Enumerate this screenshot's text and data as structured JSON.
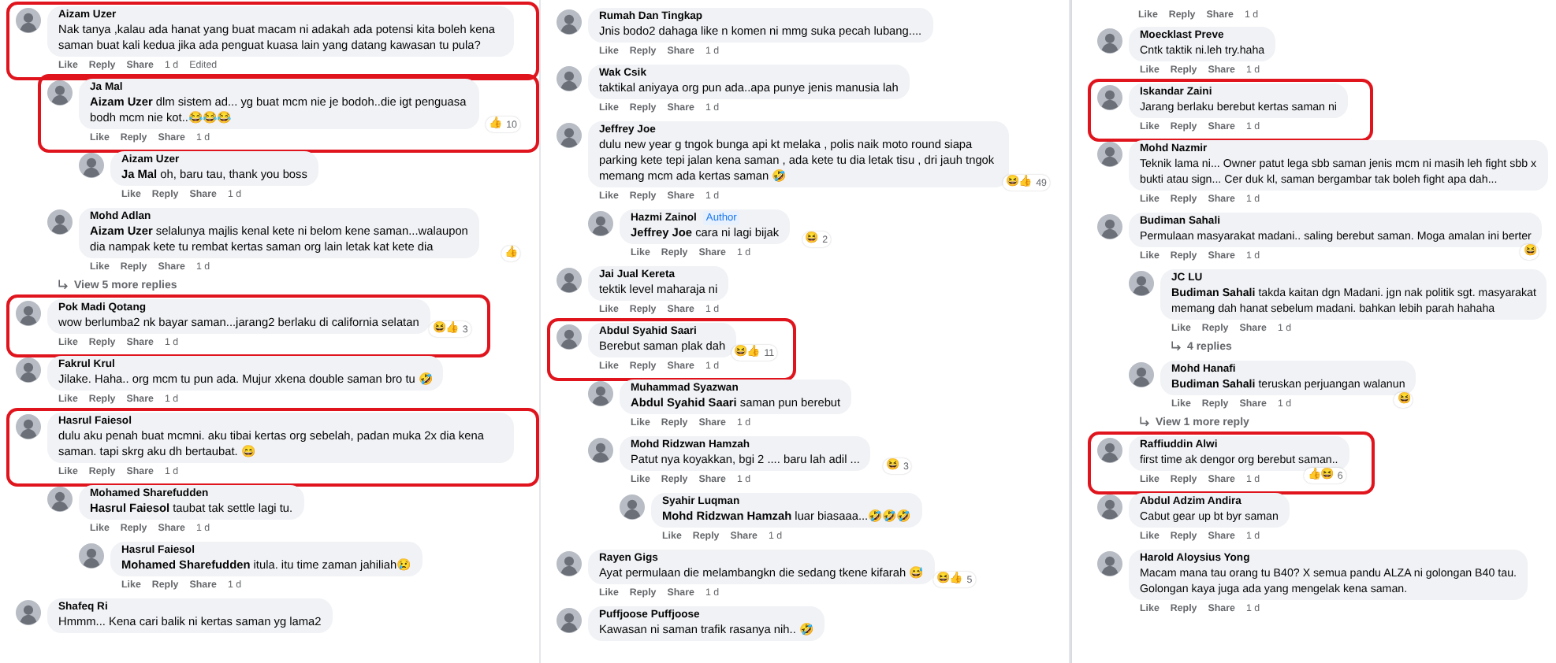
{
  "columns": [
    {
      "comments": [
        {
          "author": "Aizam Uzer",
          "text": "Nak tanya ,kalau ada hanat yang buat macam ni adakah ada potensi kita boleh kena saman buat kali kedua jika ada penguat kuasa lain yang datang kawasan tu pula?",
          "highlighted": true,
          "actions": [
            "Like",
            "Reply",
            "Share"
          ],
          "time": "1 d",
          "edited": "Edited",
          "more": "View 5 more replies",
          "children": [
            {
              "author": "Ja Mal",
              "text": "**Aizam Uzer** dlm sistem ad... yg buat mcm nie je bodoh..die igt penguasa bodh mcm nie kot..😂😂😂",
              "reactions": {
                "icons": [
                  "👍"
                ],
                "count": "10"
              },
              "highlighted": true,
              "actions": [
                "Like",
                "Reply",
                "Share"
              ],
              "time": "1 d",
              "children": [
                {
                  "author": "Aizam Uzer",
                  "text": "**Ja Mal** oh, baru tau, thank you boss",
                  "highlighted": false,
                  "actions": [
                    "Like",
                    "Reply",
                    "Share"
                  ],
                  "time": "1 d"
                }
              ]
            },
            {
              "author": "Mohd Adlan",
              "text": "**Aizam Uzer** selalunya majlis kenal kete ni belom kene saman...walaupon dia nampak kete tu rembat kertas saman org lain letak kat kete dia",
              "reactions": {
                "icons": [
                  "👍"
                ]
              },
              "highlighted": false,
              "actions": [
                "Like",
                "Reply",
                "Share"
              ],
              "time": "1 d"
            }
          ]
        },
        {
          "author": "Pok Madi Qotang",
          "text": "wow berlumba2 nk bayar saman...jarang2 berlaku di california selatan",
          "reactions": {
            "icons": [
              "😆",
              "👍"
            ],
            "count": "3"
          },
          "highlighted": true,
          "actions": [
            "Like",
            "Reply",
            "Share"
          ],
          "time": "1 d"
        },
        {
          "author": "Fakrul Krul",
          "text": "Jilake. Haha.. org mcm tu pun ada. Mujur xkena double saman bro tu 🤣",
          "highlighted": false,
          "actions": [
            "Like",
            "Reply",
            "Share"
          ],
          "time": "1 d"
        },
        {
          "author": "Hasrul Faiesol",
          "text": "dulu aku penah buat mcmni. aku tibai kertas org sebelah, padan muka 2x dia kena saman. tapi skrg aku dh bertaubat. 😄",
          "highlighted": true,
          "actions": [
            "Like",
            "Reply",
            "Share"
          ],
          "time": "1 d",
          "children": [
            {
              "author": "Mohamed Sharefudden",
              "text": "**Hasrul Faiesol** taubat tak settle lagi tu.",
              "highlighted": false,
              "actions": [
                "Like",
                "Reply",
                "Share"
              ],
              "time": "1 d",
              "children": [
                {
                  "author": "Hasrul Faiesol",
                  "text": "**Mohamed Sharefudden** itula. itu time zaman jahiliah😢",
                  "highlighted": false,
                  "actions": [
                    "Like",
                    "Reply",
                    "Share"
                  ],
                  "time": "1 d"
                }
              ]
            }
          ]
        },
        {
          "author": "Shafeq Ri",
          "text": "Hmmm... Kena cari balik ni kertas saman yg lama2",
          "highlighted": false
        }
      ]
    },
    {
      "comments": [
        {
          "author": "Rumah Dan Tingkap",
          "text": "Jnis bodo2 dahaga like n komen ni mmg suka pecah lubang....",
          "highlighted": false,
          "actions": [
            "Like",
            "Reply",
            "Share"
          ],
          "time": "1 d"
        },
        {
          "author": "Wak Csik",
          "text": "taktikal aniyaya org pun ada..apa punye jenis manusia lah",
          "highlighted": false,
          "actions": [
            "Like",
            "Reply",
            "Share"
          ],
          "time": "1 d"
        },
        {
          "author": "Jeffrey Joe",
          "text": "dulu new year g tngok bunga api kt melaka , polis naik moto round siapa parking kete tepi jalan kena saman , ada kete tu dia letak tisu , dri jauh tngok memang mcm ada kertas saman 🤣",
          "reactions": {
            "icons": [
              "😆",
              "👍"
            ],
            "count": "49"
          },
          "highlighted": false,
          "actions": [
            "Like",
            "Reply",
            "Share"
          ],
          "time": "1 d",
          "children": [
            {
              "author": "Hazmi Zainol",
              "badge": "Author",
              "text": "**Jeffrey Joe** cara ni lagi bijak",
              "reactions": {
                "icons": [
                  "😆"
                ],
                "count": "2"
              },
              "highlighted": false,
              "actions": [
                "Like",
                "Reply",
                "Share"
              ],
              "time": "1 d"
            }
          ]
        },
        {
          "author": "Jai Jual Kereta",
          "text": "tektik level maharaja ni",
          "highlighted": false,
          "actions": [
            "Like",
            "Reply",
            "Share"
          ],
          "time": "1 d"
        },
        {
          "author": "Abdul Syahid Saari",
          "text": "Berebut saman plak dah",
          "reactions": {
            "icons": [
              "😆",
              "👍"
            ],
            "count": "11"
          },
          "highlighted": true,
          "actions": [
            "Like",
            "Reply",
            "Share"
          ],
          "time": "1 d",
          "children": [
            {
              "author": "Muhammad Syazwan",
              "text": "**Abdul Syahid Saari** saman pun berebut",
              "highlighted": false,
              "actions": [
                "Like",
                "Reply",
                "Share"
              ],
              "time": "1 d"
            },
            {
              "author": "Mohd Ridzwan Hamzah",
              "text": "Patut nya koyakkan, bgi 2 .... baru lah adil ...",
              "reactions": {
                "icons": [
                  "😆"
                ],
                "count": "3"
              },
              "highlighted": false,
              "actions": [
                "Like",
                "Reply",
                "Share"
              ],
              "time": "1 d",
              "children": [
                {
                  "author": "Syahir Luqman",
                  "text": "**Mohd Ridzwan Hamzah** luar biasaaa...🤣🤣🤣",
                  "highlighted": false,
                  "actions": [
                    "Like",
                    "Reply",
                    "Share"
                  ],
                  "time": "1 d"
                }
              ]
            }
          ]
        },
        {
          "author": "Rayen Gigs",
          "text": "Ayat permulaan die melambangkn die sedang tkene kifarah 😅",
          "reactions": {
            "icons": [
              "😆",
              "👍"
            ],
            "count": "5"
          },
          "highlighted": false,
          "actions": [
            "Like",
            "Reply",
            "Share"
          ],
          "time": "1 d"
        },
        {
          "author": "Puffjoose Puffjoose",
          "text": "Kawasan ni saman trafik rasanya nih.. 🤣",
          "highlighted": false
        }
      ]
    },
    {
      "orphan_actions": {
        "actions": [
          "Like",
          "Reply",
          "Share"
        ],
        "time": "1 d"
      },
      "comments": [
        {
          "author": "Moecklast Preve",
          "text": "Cntk taktik ni.leh try.haha",
          "highlighted": false,
          "actions": [
            "Like",
            "Reply",
            "Share"
          ],
          "time": "1 d"
        },
        {
          "author": "Iskandar Zaini",
          "text": "Jarang berlaku berebut kertas saman ni",
          "highlighted": true,
          "actions": [
            "Like",
            "Reply",
            "Share"
          ],
          "time": "1 d"
        },
        {
          "author": "Mohd Nazmir",
          "text": "Teknik lama ni... Owner patut lega sbb saman jenis mcm ni masih leh fight sbb x\nbukti atau sign... Cer duk kl, saman bergambar tak boleh fight apa dah...",
          "highlighted": false,
          "actions": [
            "Like",
            "Reply",
            "Share"
          ],
          "time": "1 d"
        },
        {
          "author": "Budiman Sahali",
          "text": "Permulaan masyarakat madani.. saling berebut saman. Moga amalan ini berter",
          "reactions": {
            "icons": [
              "😆"
            ]
          },
          "highlighted": false,
          "actions": [
            "Like",
            "Reply",
            "Share"
          ],
          "time": "1 d",
          "more": "View 1 more reply",
          "children": [
            {
              "author": "JC LU",
              "text": "**Budiman Sahali** takda kaitan dgn Madani. jgn nak politik sgt. masyarakat\nmemang dah hanat sebelum madani. bahkan lebih parah hahaha",
              "highlighted": false,
              "actions": [
                "Like",
                "Reply",
                "Share"
              ],
              "time": "1 d",
              "more": "4 replies"
            },
            {
              "author": "Mohd Hanafi",
              "text": "**Budiman Sahali** teruskan perjuangan walanun",
              "reactions": {
                "icons": [
                  "😆"
                ]
              },
              "highlighted": false,
              "actions": [
                "Like",
                "Reply",
                "Share"
              ],
              "time": "1 d"
            }
          ]
        },
        {
          "author": "Raffiuddin Alwi",
          "text": "first time ak dengor org berebut saman..",
          "reactions": {
            "icons": [
              "👍",
              "😆"
            ],
            "count": "6"
          },
          "highlighted": true,
          "actions": [
            "Like",
            "Reply",
            "Share"
          ],
          "time": "1 d"
        },
        {
          "author": "Abdul Adzim Andira",
          "text": "Cabut gear up bt byr saman",
          "highlighted": false,
          "actions": [
            "Like",
            "Reply",
            "Share"
          ],
          "time": "1 d"
        },
        {
          "author": "Harold Aloysius Yong",
          "text": "Macam mana tau orang tu B40? X semua pandu ALZA ni golongan B40 tau.\nGolongan kaya juga ada yang mengelak kena saman.",
          "highlighted": false,
          "actions": [
            "Like",
            "Reply",
            "Share"
          ],
          "time": "1 d"
        }
      ]
    }
  ]
}
